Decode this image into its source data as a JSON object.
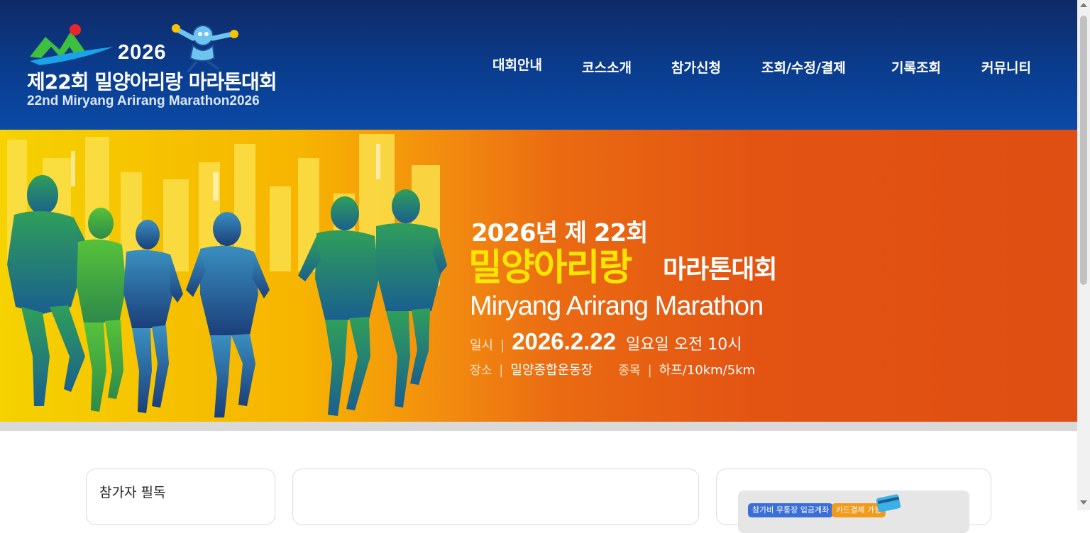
{
  "header": {
    "logo": {
      "year": "2026",
      "title": "제22회 밀양아리랑 마라톤대회",
      "subtitle": "22nd Miryang Arirang Marathon2026"
    },
    "nav": [
      "대회안내",
      "코스소개",
      "참가신청",
      "조회/수정/결제",
      "기록조회",
      "커뮤니티"
    ]
  },
  "banner": {
    "line1": "2026년 제 22회",
    "line2_highlight": "밀양아리랑",
    "line2_rest": "마라톤대회",
    "line3": "Miryang Arirang Marathon",
    "date_label": "일시",
    "date": "2026.2.22",
    "date_rest": "일요일 오전 10시",
    "place_label": "장소",
    "place": "밀양종합운동장",
    "event_label": "종목",
    "event": "하프/10km/5km",
    "colors": {
      "highlight": "#ffe500",
      "bg_left": "#f5d200",
      "bg_right": "#df4e12"
    }
  },
  "cards": {
    "left_title": "참가자 필독",
    "right_pill_1": "참가비 무통장 입금계좌",
    "right_pill_2": "카드결제 가능"
  },
  "colors": {
    "header_bg": "#0a3d8f",
    "accent": "#ffe500"
  }
}
